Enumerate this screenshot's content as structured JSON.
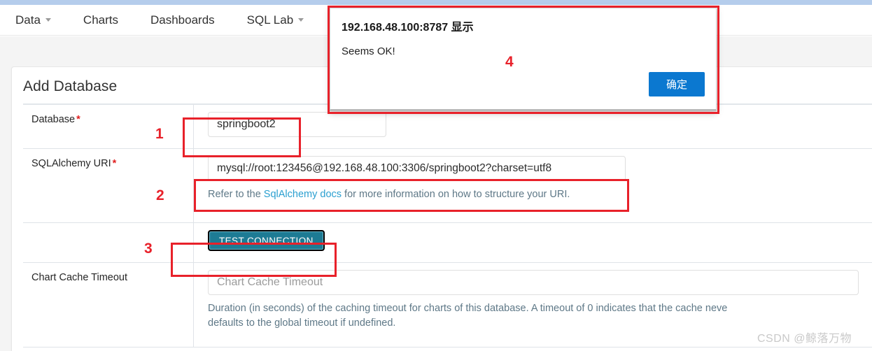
{
  "navbar": {
    "items": [
      {
        "label": "Data",
        "caret": true
      },
      {
        "label": "Charts",
        "caret": false
      },
      {
        "label": "Dashboards",
        "caret": false
      },
      {
        "label": "SQL Lab",
        "caret": true
      }
    ]
  },
  "card": {
    "title": "Add Database",
    "rows": {
      "database": {
        "label": "Database",
        "required_marker": "*",
        "value": "springboot2",
        "annotation": "1"
      },
      "sqlalchemy_uri": {
        "label": "SQLAlchemy URI",
        "required_marker": "*",
        "value": "mysql://root:123456@192.168.48.100:3306/springboot2?charset=utf8",
        "annotation": "2",
        "help_prefix": "Refer to the ",
        "help_link": "SqlAlchemy docs",
        "help_suffix": " for more information on how to structure your URI."
      },
      "test_connection": {
        "button_label": "TEST CONNECTION",
        "annotation": "3"
      },
      "chart_cache_timeout": {
        "label": "Chart Cache Timeout",
        "placeholder": "Chart Cache Timeout",
        "help_line1": "Duration (in seconds) of the caching timeout for charts of this database. A timeout of 0 indicates that the cache neve",
        "help_line2": "defaults to the global timeout if undefined."
      }
    }
  },
  "dialog": {
    "title": "192.168.48.100:8787 显示",
    "message": "Seems OK!",
    "confirm_label": "确定",
    "annotation": "4"
  },
  "watermark": "CSDN @鲸落万物",
  "colors": {
    "annotation_red": "#e8212a",
    "dialog_button_blue": "#0b78d0",
    "test_button_teal": "#1d7b94",
    "link_blue": "#2a9fd0",
    "required_red": "#e02020"
  }
}
